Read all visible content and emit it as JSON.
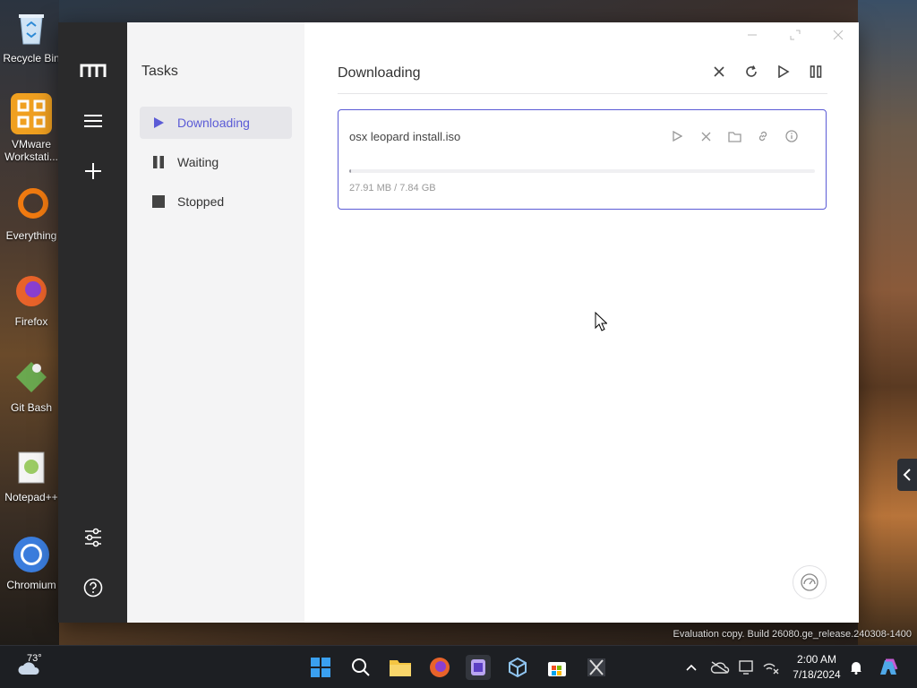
{
  "desktop": {
    "icons": [
      {
        "label": "Recycle Bin",
        "icon": "recycle-bin-icon",
        "color": "#d9e6f2"
      },
      {
        "label": "VMware Workstati...",
        "icon": "vmware-icon",
        "color": "#f0a020"
      },
      {
        "label": "Everything",
        "icon": "everything-icon",
        "color": "#f07a10"
      },
      {
        "label": "Firefox",
        "icon": "firefox-icon",
        "color": "#e8632a"
      },
      {
        "label": "Git Bash",
        "icon": "git-bash-icon",
        "color": "#6aa84f"
      },
      {
        "label": "Notepad++",
        "icon": "notepad-plus-icon",
        "color": "#9ccc65"
      },
      {
        "label": "Chromium",
        "icon": "chromium-icon",
        "color": "#3b7ddd"
      }
    ],
    "watermark": "Evaluation copy. Build 26080.ge_release.240308-1400"
  },
  "app": {
    "accent": "#5b5bd6",
    "sidebar": {
      "title": "Tasks",
      "items": [
        {
          "label": "Downloading",
          "icon": "play-icon",
          "active": true
        },
        {
          "label": "Waiting",
          "icon": "pause-icon",
          "active": false
        },
        {
          "label": "Stopped",
          "icon": "stop-icon",
          "active": false
        }
      ]
    },
    "main": {
      "title": "Downloading",
      "task": {
        "name": "osx leopard install.iso",
        "size": "27.91 MB / 7.84 GB",
        "progress_percent": 0.35
      }
    }
  },
  "taskbar": {
    "weather": "73°",
    "time": "2:00 AM",
    "date": "7/18/2024"
  }
}
